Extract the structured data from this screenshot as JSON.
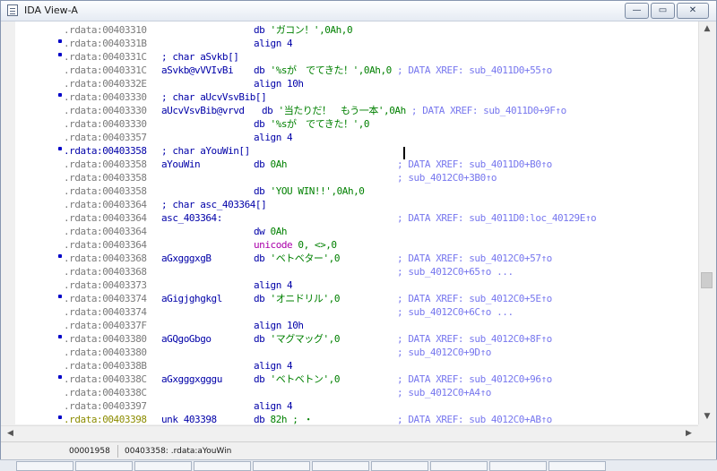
{
  "window": {
    "title": "IDA View-A",
    "buttons": {
      "minimize": "—",
      "maximize": "▭",
      "close": "✕"
    }
  },
  "lines": [
    {
      "bullet": false,
      "addr": ".rdata:00403310",
      "label": "",
      "mnem": "db ",
      "operands": [
        {
          "t": "'ガコン！'",
          "c": "str"
        },
        {
          "t": ",0Ah,0",
          "c": "num"
        }
      ],
      "comment": ""
    },
    {
      "bullet": true,
      "addr": ".rdata:0040331B",
      "label": "",
      "mnem": "align 4",
      "operands": [],
      "comment": ""
    },
    {
      "bullet": true,
      "addr": ".rdata:0040331C",
      "label": "; char aSvkb[]",
      "labelClass": "decl",
      "mnem": "",
      "operands": [],
      "comment": ""
    },
    {
      "bullet": false,
      "addr": ".rdata:0040331C",
      "label": "aSvkb@vVVIvBi",
      "mnem": "db ",
      "operands": [
        {
          "t": "'%sが　でてきた！'",
          "c": "str"
        },
        {
          "t": ",0Ah,0",
          "c": "num"
        }
      ],
      "comment": "",
      "inline": " ; DATA XREF: sub_4011D0+55↑o"
    },
    {
      "bullet": false,
      "addr": ".rdata:0040332E",
      "label": "",
      "mnem": "align 10h",
      "operands": [],
      "comment": ""
    },
    {
      "bullet": true,
      "addr": ".rdata:00403330",
      "label": "; char aUcvVsvBib[]",
      "labelClass": "decl",
      "mnem": "",
      "operands": [],
      "comment": ""
    },
    {
      "bullet": false,
      "addr": ".rdata:00403330",
      "label": "aUcvVsvBib@vrvd",
      "mnem": "db ",
      "operands": [
        {
          "t": "'当たりだ！　もう一本'",
          "c": "str"
        },
        {
          "t": ",0Ah",
          "c": "num"
        }
      ],
      "comment": "",
      "inline": " ; DATA XREF: sub_4011D0+9F↑o",
      "mnemShift": true
    },
    {
      "bullet": false,
      "addr": ".rdata:00403330",
      "label": "",
      "mnem": "db ",
      "operands": [
        {
          "t": "'%sが　でてきた！'",
          "c": "str"
        },
        {
          "t": ",0",
          "c": "num"
        }
      ],
      "comment": ""
    },
    {
      "bullet": false,
      "addr": ".rdata:00403357",
      "label": "",
      "mnem": "align 4",
      "operands": [],
      "comment": ""
    },
    {
      "bullet": true,
      "addr": ".rdata:00403358",
      "addrClass": "cur",
      "label": "; char aYouWin[]",
      "labelClass": "decl",
      "mnem": "",
      "operands": [],
      "comment": ""
    },
    {
      "bullet": false,
      "addr": ".rdata:00403358",
      "label": "aYouWin",
      "mnem": "db ",
      "operands": [
        {
          "t": "0Ah",
          "c": "num"
        }
      ],
      "comment": "; DATA XREF: sub_4011D0+B0↑o"
    },
    {
      "bullet": false,
      "addr": ".rdata:00403358",
      "label": "",
      "mnem": "",
      "operands": [],
      "comment": "; sub_4012C0+3B0↑o"
    },
    {
      "bullet": false,
      "addr": ".rdata:00403358",
      "label": "",
      "mnem": "db ",
      "operands": [
        {
          "t": "'YOU WIN!!'",
          "c": "str"
        },
        {
          "t": ",0Ah,0",
          "c": "num"
        }
      ],
      "comment": ""
    },
    {
      "bullet": false,
      "addr": ".rdata:00403364",
      "label": "; char asc_403364[]",
      "labelClass": "decl",
      "mnem": "",
      "operands": [],
      "comment": ""
    },
    {
      "bullet": false,
      "addr": ".rdata:00403364",
      "label": "asc_403364:",
      "mnem": "",
      "operands": [],
      "comment": "; DATA XREF: sub_4011D0:loc_40129E↑o"
    },
    {
      "bullet": false,
      "addr": ".rdata:00403364",
      "label": "",
      "mnem": "dw ",
      "operands": [
        {
          "t": "0Ah",
          "c": "num"
        }
      ],
      "comment": ""
    },
    {
      "bullet": false,
      "addr": ".rdata:00403364",
      "label": "",
      "mnem": "unicode ",
      "mnemClass": "unicode",
      "operands": [
        {
          "t": "0, <>,0",
          "c": "num"
        }
      ],
      "comment": ""
    },
    {
      "bullet": true,
      "addr": ".rdata:00403368",
      "label": "aGxgggxgB",
      "mnem": "db ",
      "operands": [
        {
          "t": "'ベトベター'",
          "c": "str"
        },
        {
          "t": ",0",
          "c": "num"
        }
      ],
      "comment": "; DATA XREF: sub_4012C0+57↑o"
    },
    {
      "bullet": false,
      "addr": ".rdata:00403368",
      "label": "",
      "mnem": "",
      "operands": [],
      "comment": "; sub_4012C0+65↑o ..."
    },
    {
      "bullet": false,
      "addr": ".rdata:00403373",
      "label": "",
      "mnem": "align 4",
      "operands": [],
      "comment": ""
    },
    {
      "bullet": true,
      "addr": ".rdata:00403374",
      "label": "aGigjghgkgl",
      "mnem": "db ",
      "operands": [
        {
          "t": "'オニドリル'",
          "c": "str"
        },
        {
          "t": ",0",
          "c": "num"
        }
      ],
      "comment": "; DATA XREF: sub_4012C0+5E↑o"
    },
    {
      "bullet": false,
      "addr": ".rdata:00403374",
      "label": "",
      "mnem": "",
      "operands": [],
      "comment": "; sub_4012C0+6C↑o ..."
    },
    {
      "bullet": false,
      "addr": ".rdata:0040337F",
      "label": "",
      "mnem": "align 10h",
      "operands": [],
      "comment": ""
    },
    {
      "bullet": true,
      "addr": ".rdata:00403380",
      "label": "aGQgoGbgo",
      "mnem": "db ",
      "operands": [
        {
          "t": "'マグマッグ'",
          "c": "str"
        },
        {
          "t": ",0",
          "c": "num"
        }
      ],
      "comment": "; DATA XREF: sub_4012C0+8F↑o"
    },
    {
      "bullet": false,
      "addr": ".rdata:00403380",
      "label": "",
      "mnem": "",
      "operands": [],
      "comment": "; sub_4012C0+9D↑o"
    },
    {
      "bullet": false,
      "addr": ".rdata:0040338B",
      "label": "",
      "mnem": "align 4",
      "operands": [],
      "comment": ""
    },
    {
      "bullet": true,
      "addr": ".rdata:0040338C",
      "label": "aGxgggxgggu",
      "mnem": "db ",
      "operands": [
        {
          "t": "'ベトベトン'",
          "c": "str"
        },
        {
          "t": ",0",
          "c": "num"
        }
      ],
      "comment": "; DATA XREF: sub_4012C0+96↑o"
    },
    {
      "bullet": false,
      "addr": ".rdata:0040338C",
      "label": "",
      "mnem": "",
      "operands": [],
      "comment": "; sub_4012C0+A4↑o"
    },
    {
      "bullet": false,
      "addr": ".rdata:00403397",
      "label": "",
      "mnem": "align 4",
      "operands": [],
      "comment": ""
    },
    {
      "bullet": true,
      "addr": ".rdata:00403398",
      "addrClass": "hl",
      "label": "unk_403398",
      "mnem": "db ",
      "operands": [
        {
          "t": "82h ; ・",
          "c": "num"
        }
      ],
      "comment": "; DATA XREF: sub_4012C0+AB↑o"
    }
  ],
  "status": {
    "offset": "00001958",
    "location": "00403358: .rdata:aYouWin"
  },
  "scroll": {
    "vertical_position": 0.66
  },
  "colors": {
    "address": "#7a7a7a",
    "keyword": "#0000a8",
    "string": "#008000",
    "comment": "#7777ee",
    "unicode": "#aa00aa"
  }
}
